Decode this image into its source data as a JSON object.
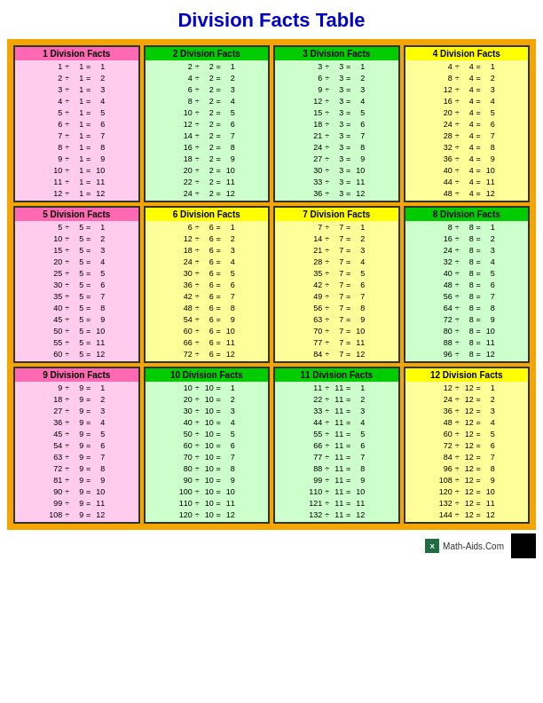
{
  "title": "Division Facts Table",
  "sections": [
    {
      "id": 1,
      "label": "1 Division Facts",
      "divisor": 1,
      "facts": [
        "1 ÷ 1 = 1",
        "2 ÷ 1 = 2",
        "3 ÷ 1 = 3",
        "4 ÷ 1 = 4",
        "5 ÷ 1 = 5",
        "6 ÷ 1 = 6",
        "7 ÷ 1 = 7",
        "8 ÷ 1 = 8",
        "9 ÷ 1 = 9",
        "10 ÷ 1 = 10",
        "11 ÷ 1 = 11",
        "12 ÷ 1 = 12"
      ]
    },
    {
      "id": 2,
      "label": "2 Division Facts",
      "divisor": 2,
      "facts": [
        "2 ÷ 2 = 1",
        "4 ÷ 2 = 2",
        "6 ÷ 2 = 3",
        "8 ÷ 2 = 4",
        "10 ÷ 2 = 5",
        "12 ÷ 2 = 6",
        "14 ÷ 2 = 7",
        "16 ÷ 2 = 8",
        "18 ÷ 2 = 9",
        "20 ÷ 2 = 10",
        "22 ÷ 2 = 11",
        "24 ÷ 2 = 12"
      ]
    },
    {
      "id": 3,
      "label": "3 Division Facts",
      "divisor": 3,
      "facts": [
        "3 ÷ 3 = 1",
        "6 ÷ 3 = 2",
        "9 ÷ 3 = 3",
        "12 ÷ 3 = 4",
        "15 ÷ 3 = 5",
        "18 ÷ 3 = 6",
        "21 ÷ 3 = 7",
        "24 ÷ 3 = 8",
        "27 ÷ 3 = 9",
        "30 ÷ 3 = 10",
        "33 ÷ 3 = 11",
        "36 ÷ 3 = 12"
      ]
    },
    {
      "id": 4,
      "label": "4 Division Facts",
      "divisor": 4,
      "facts": [
        "4 ÷ 4 = 1",
        "8 ÷ 4 = 2",
        "12 ÷ 4 = 3",
        "16 ÷ 4 = 4",
        "20 ÷ 4 = 5",
        "24 ÷ 4 = 6",
        "28 ÷ 4 = 7",
        "32 ÷ 4 = 8",
        "36 ÷ 4 = 9",
        "40 ÷ 4 = 10",
        "44 ÷ 4 = 11",
        "48 ÷ 4 = 12"
      ]
    },
    {
      "id": 5,
      "label": "5 Division Facts",
      "divisor": 5,
      "facts": [
        "5 ÷ 5 = 1",
        "10 ÷ 5 = 2",
        "15 ÷ 5 = 3",
        "20 ÷ 5 = 4",
        "25 ÷ 5 = 5",
        "30 ÷ 5 = 6",
        "35 ÷ 5 = 7",
        "40 ÷ 5 = 8",
        "45 ÷ 5 = 9",
        "50 ÷ 5 = 10",
        "55 ÷ 5 = 11",
        "60 ÷ 5 = 12"
      ]
    },
    {
      "id": 6,
      "label": "6 Division Facts",
      "divisor": 6,
      "facts": [
        "6 ÷ 6 = 1",
        "12 ÷ 6 = 2",
        "18 ÷ 6 = 3",
        "24 ÷ 6 = 4",
        "30 ÷ 6 = 5",
        "36 ÷ 6 = 6",
        "42 ÷ 6 = 7",
        "48 ÷ 6 = 8",
        "54 ÷ 6 = 9",
        "60 ÷ 6 = 10",
        "66 ÷ 6 = 11",
        "72 ÷ 6 = 12"
      ]
    },
    {
      "id": 7,
      "label": "7 Division Facts",
      "divisor": 7,
      "facts": [
        "7 ÷ 7 = 1",
        "14 ÷ 7 = 2",
        "21 ÷ 7 = 3",
        "28 ÷ 7 = 4",
        "35 ÷ 7 = 5",
        "42 ÷ 7 = 6",
        "49 ÷ 7 = 7",
        "56 ÷ 7 = 8",
        "63 ÷ 7 = 9",
        "70 ÷ 7 = 10",
        "77 ÷ 7 = 11",
        "84 ÷ 7 = 12"
      ]
    },
    {
      "id": 8,
      "label": "8 Division Facts",
      "divisor": 8,
      "facts": [
        "8 ÷ 8 = 1",
        "16 ÷ 8 = 2",
        "24 ÷ 8 = 3",
        "32 ÷ 8 = 4",
        "40 ÷ 8 = 5",
        "48 ÷ 8 = 6",
        "56 ÷ 8 = 7",
        "64 ÷ 8 = 8",
        "72 ÷ 8 = 9",
        "80 ÷ 8 = 10",
        "88 ÷ 8 = 11",
        "96 ÷ 8 = 12"
      ]
    },
    {
      "id": 9,
      "label": "9 Division Facts",
      "divisor": 9,
      "facts": [
        "9 ÷ 9 = 1",
        "18 ÷ 9 = 2",
        "27 ÷ 9 = 3",
        "36 ÷ 9 = 4",
        "45 ÷ 9 = 5",
        "54 ÷ 9 = 6",
        "63 ÷ 9 = 7",
        "72 ÷ 9 = 8",
        "81 ÷ 9 = 9",
        "90 ÷ 9 = 10",
        "99 ÷ 9 = 11",
        "108 ÷ 9 = 12"
      ]
    },
    {
      "id": 10,
      "label": "10 Division Facts",
      "divisor": 10,
      "facts": [
        "10 ÷ 10 = 1",
        "20 ÷ 10 = 2",
        "30 ÷ 10 = 3",
        "40 ÷ 10 = 4",
        "50 ÷ 10 = 5",
        "60 ÷ 10 = 6",
        "70 ÷ 10 = 7",
        "80 ÷ 10 = 8",
        "90 ÷ 10 = 9",
        "100 ÷ 10 = 10",
        "110 ÷ 10 = 11",
        "120 ÷ 10 = 12"
      ]
    },
    {
      "id": 11,
      "label": "11 Division Facts",
      "divisor": 11,
      "facts": [
        "11 ÷ 11 = 1",
        "22 ÷ 11 = 2",
        "33 ÷ 11 = 3",
        "44 ÷ 11 = 4",
        "55 ÷ 11 = 5",
        "66 ÷ 11 = 6",
        "77 ÷ 11 = 7",
        "88 ÷ 11 = 8",
        "99 ÷ 11 = 9",
        "110 ÷ 11 = 10",
        "121 ÷ 11 = 11",
        "132 ÷ 11 = 12"
      ]
    },
    {
      "id": 12,
      "label": "12 Division Facts",
      "divisor": 12,
      "facts": [
        "12 ÷ 12 = 1",
        "24 ÷ 12 = 2",
        "36 ÷ 12 = 3",
        "48 ÷ 12 = 4",
        "60 ÷ 12 = 5",
        "72 ÷ 12 = 6",
        "84 ÷ 12 = 7",
        "96 ÷ 12 = 8",
        "108 ÷ 12 = 9",
        "120 ÷ 12 = 10",
        "132 ÷ 12 = 11",
        "144 ÷ 12 = 12"
      ]
    }
  ],
  "footer": {
    "site": "Math-Aids.Com"
  }
}
